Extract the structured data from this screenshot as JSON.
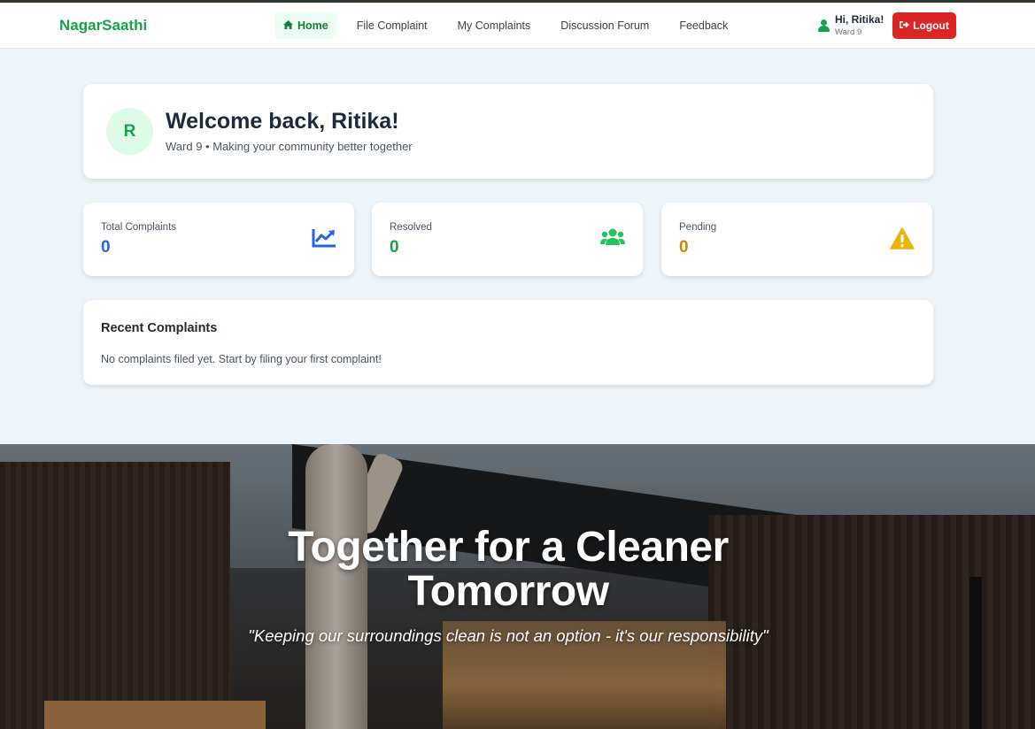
{
  "brand": "NagarSaathi",
  "nav": {
    "items": [
      {
        "label": "Home",
        "icon": "home-icon",
        "active": true
      },
      {
        "label": "File Complaint",
        "active": false
      },
      {
        "label": "My Complaints",
        "active": false
      },
      {
        "label": "Discussion Forum",
        "active": false
      },
      {
        "label": "Feedback",
        "active": false
      }
    ],
    "user_greeting": "Hi, Ritika!",
    "user_ward": "Ward 9",
    "logout_label": "Logout"
  },
  "welcome": {
    "avatar_initial": "R",
    "title": "Welcome back, Ritika!",
    "subtitle": "Ward 9 • Making your community better together"
  },
  "stats": [
    {
      "label": "Total Complaints",
      "value": "0",
      "color": "#2563eb",
      "icon": "chart-line-icon"
    },
    {
      "label": "Resolved",
      "value": "0",
      "color": "#16a34a",
      "icon": "users-icon"
    },
    {
      "label": "Pending",
      "value": "0",
      "color": "#ca8a04",
      "icon": "warning-icon"
    }
  ],
  "recent": {
    "title": "Recent Complaints",
    "empty_message": "No complaints filed yet. Start by filing your first complaint!"
  },
  "hero": {
    "title": "Together for a Cleaner Tomorrow",
    "quote": "\"Keeping our surroundings clean is not an option - it's our responsibility\""
  },
  "colors": {
    "brand": "#16a34a",
    "logout": "#dc2626",
    "page_bg": "#eef5fa"
  }
}
